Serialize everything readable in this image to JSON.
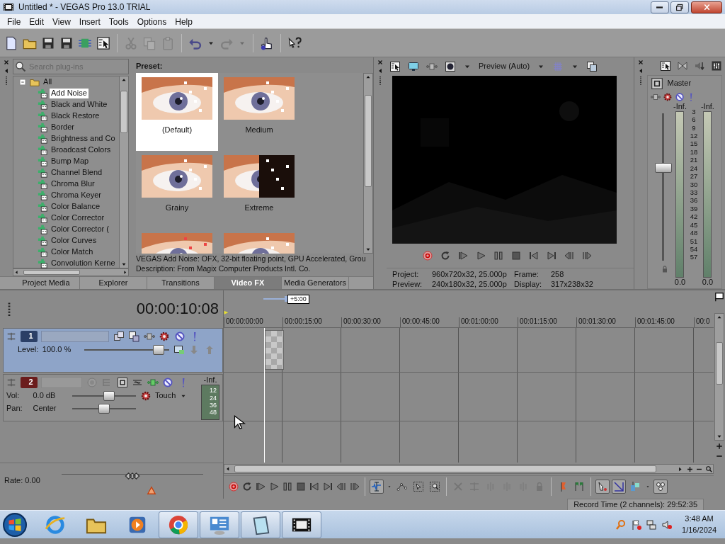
{
  "window": {
    "title": "Untitled * - VEGAS Pro 13.0 TRIAL"
  },
  "menu": [
    "File",
    "Edit",
    "View",
    "Insert",
    "Tools",
    "Options",
    "Help"
  ],
  "toolbar": [
    {
      "kind": "page",
      "disabled": false
    },
    {
      "kind": "folder",
      "disabled": false
    },
    {
      "kind": "floppy",
      "disabled": false
    },
    {
      "kind": "floppy",
      "disabled": false
    },
    {
      "kind": "chip",
      "disabled": false
    },
    {
      "kind": "window-cursor",
      "disabled": false
    },
    {
      "kind": "separator"
    },
    {
      "kind": "scissors",
      "disabled": true
    },
    {
      "kind": "copy",
      "disabled": true
    },
    {
      "kind": "clipboard",
      "disabled": true
    },
    {
      "kind": "separator"
    },
    {
      "kind": "undo",
      "disabled": false
    },
    {
      "kind": "caret",
      "disabled": false
    },
    {
      "kind": "redo",
      "disabled": true
    },
    {
      "kind": "caret",
      "disabled": true
    },
    {
      "kind": "separator"
    },
    {
      "kind": "hand",
      "disabled": false
    },
    {
      "kind": "separator"
    },
    {
      "kind": "help",
      "disabled": false
    }
  ],
  "plugins": {
    "search": {
      "placeholder": "Search plug-ins"
    },
    "tree": [
      {
        "label": "All",
        "expanded": true,
        "children": [
          {
            "label": "Add Noise",
            "selected": true
          },
          {
            "label": "Black and White",
            "selected": false
          },
          {
            "label": "Black Restore",
            "selected": false
          },
          {
            "label": "Border",
            "selected": false
          },
          {
            "label": "Brightness and Co",
            "selected": false
          },
          {
            "label": "Broadcast Colors",
            "selected": false
          },
          {
            "label": "Bump Map",
            "selected": false
          },
          {
            "label": "Channel Blend",
            "selected": false
          },
          {
            "label": "Chroma Blur",
            "selected": false
          },
          {
            "label": "Chroma Keyer",
            "selected": false
          },
          {
            "label": "Color Balance",
            "selected": false
          },
          {
            "label": "Color Corrector",
            "selected": false
          },
          {
            "label": "Color Corrector (",
            "selected": false
          },
          {
            "label": "Color Curves",
            "selected": false
          },
          {
            "label": "Color Match",
            "selected": false
          },
          {
            "label": "Convolution Kerne",
            "selected": false
          }
        ]
      }
    ]
  },
  "presets": {
    "heading": "Preset:",
    "items": [
      {
        "label": "(Default)",
        "selected": true
      },
      {
        "label": "Medium",
        "selected": false
      },
      {
        "label": "Grainy",
        "selected": false
      },
      {
        "label": "Extreme",
        "selected": false
      },
      {
        "selected": false
      },
      {
        "selected": false
      }
    ],
    "description": [
      "VEGAS Add Noise: OFX, 32-bit floating point, GPU Accelerated, Grou",
      "Description: From Magix Computer Products Intl. Co."
    ]
  },
  "dock_tabs": [
    {
      "label": "Project Media",
      "selected": false
    },
    {
      "label": "Explorer",
      "selected": false
    },
    {
      "label": "Transitions",
      "selected": false
    },
    {
      "label": "Video FX",
      "selected": true
    },
    {
      "label": "Media Generators",
      "selected": false
    }
  ],
  "preview": {
    "mode": "Preview (Auto)",
    "transport": [
      {
        "kind": "record"
      },
      {
        "kind": "loop"
      },
      {
        "kind": "play-start"
      },
      {
        "kind": "play"
      },
      {
        "kind": "pause"
      },
      {
        "kind": "stop"
      },
      {
        "kind": "prev"
      },
      {
        "kind": "next"
      },
      {
        "kind": "prev-frame"
      },
      {
        "kind": "next-frame"
      }
    ],
    "info": [
      {
        "label": "Project:",
        "value": "960x720x32, 25.000p"
      },
      {
        "label": "Frame:",
        "value": "258"
      },
      {
        "label": "Preview:",
        "value": "240x180x32, 25.000p"
      },
      {
        "label": "Display:",
        "value": "317x238x32"
      }
    ]
  },
  "master": {
    "label": "Master",
    "level": 0.64,
    "scale": [
      "3",
      "6",
      "9",
      "12",
      "15",
      "18",
      "21",
      "24",
      "27",
      "30",
      "33",
      "36",
      "39",
      "42",
      "45",
      "48",
      "51",
      "54",
      "57"
    ],
    "meters": [
      {
        "peak": "-Inf.",
        "reading": "0.0"
      },
      {
        "peak": "-Inf.",
        "reading": "0.0"
      }
    ]
  },
  "timecode": "00:00:10:08",
  "tracks": [
    {
      "kind": "video",
      "number": "1",
      "selected": true,
      "controls": [
        {
          "label": "Level:",
          "value": "100.0 %",
          "level": 0.93
        }
      ]
    },
    {
      "kind": "audio",
      "number": "2",
      "selected": false,
      "automation": "Touch",
      "meter": {
        "peak": "-Inf.",
        "scale": [
          "12",
          "24",
          "36",
          "48"
        ]
      },
      "controls": [
        {
          "label": "Vol:",
          "value": "0.0 dB",
          "level": 0.6
        },
        {
          "label": "Pan:",
          "value": "Center",
          "level": 0.5
        }
      ]
    }
  ],
  "rate": {
    "label": "Rate: 0.00",
    "level": 0.5
  },
  "timeline": {
    "zoom": {
      "label": "+5:00",
      "level": 1
    },
    "ruler": [
      "00:00:00:00",
      "00:00:15:00",
      "00:00:30:00",
      "00:00:45:00",
      "00:01:00:00",
      "00:01:15:00",
      "00:01:30:00",
      "00:01:45:00",
      "00:0"
    ],
    "transport": [
      {
        "kind": "record"
      },
      {
        "kind": "loop"
      },
      {
        "kind": "play-start"
      },
      {
        "kind": "play"
      },
      {
        "kind": "pause"
      },
      {
        "kind": "stop"
      },
      {
        "kind": "prev"
      },
      {
        "kind": "next"
      },
      {
        "kind": "prev-frame"
      },
      {
        "kind": "next-frame"
      }
    ],
    "tools": [
      {
        "kind": "edit-tool",
        "selected": true,
        "disabled": false
      },
      {
        "kind": "caret",
        "selected": false,
        "disabled": false
      },
      {
        "kind": "nodes",
        "selected": false,
        "disabled": false
      },
      {
        "kind": "selection",
        "selected": false,
        "disabled": false
      },
      {
        "kind": "zoom-box",
        "selected": false,
        "disabled": false
      },
      {
        "kind": "separator"
      },
      {
        "kind": "delete",
        "selected": false,
        "disabled": true
      },
      {
        "kind": "trim",
        "selected": false,
        "disabled": true
      },
      {
        "kind": "split",
        "selected": false,
        "disabled": true
      },
      {
        "kind": "split",
        "selected": false,
        "disabled": true
      },
      {
        "kind": "split",
        "selected": false,
        "disabled": true
      },
      {
        "kind": "lock",
        "selected": false,
        "disabled": true
      },
      {
        "kind": "separator"
      },
      {
        "kind": "marker",
        "selected": false,
        "disabled": false
      },
      {
        "kind": "region",
        "selected": false,
        "disabled": false
      },
      {
        "kind": "separator"
      },
      {
        "kind": "pointer",
        "selected": true,
        "disabled": false
      },
      {
        "kind": "diagonal",
        "selected": true,
        "disabled": false
      },
      {
        "kind": "blocks",
        "selected": false,
        "disabled": false
      },
      {
        "kind": "caret",
        "selected": false,
        "disabled": false
      },
      {
        "kind": "circles",
        "selected": true,
        "disabled": false
      }
    ]
  },
  "status": "Record Time (2 channels): 29:52:35",
  "taskbar": {
    "apps": [
      {
        "kind": "globe",
        "selected": false
      },
      {
        "kind": "folder",
        "selected": false
      },
      {
        "kind": "media",
        "selected": false
      },
      {
        "kind": "browser",
        "selected": true
      },
      {
        "kind": "panel",
        "selected": true
      },
      {
        "kind": "notepad",
        "selected": true
      },
      {
        "kind": "film",
        "selected": true
      }
    ],
    "tray": [
      {
        "kind": "tray-search"
      },
      {
        "kind": "tray-flag"
      },
      {
        "kind": "network"
      },
      {
        "kind": "speaker-muted"
      }
    ],
    "clock": {
      "time": "3:48 AM",
      "date": "1/16/2024"
    }
  }
}
